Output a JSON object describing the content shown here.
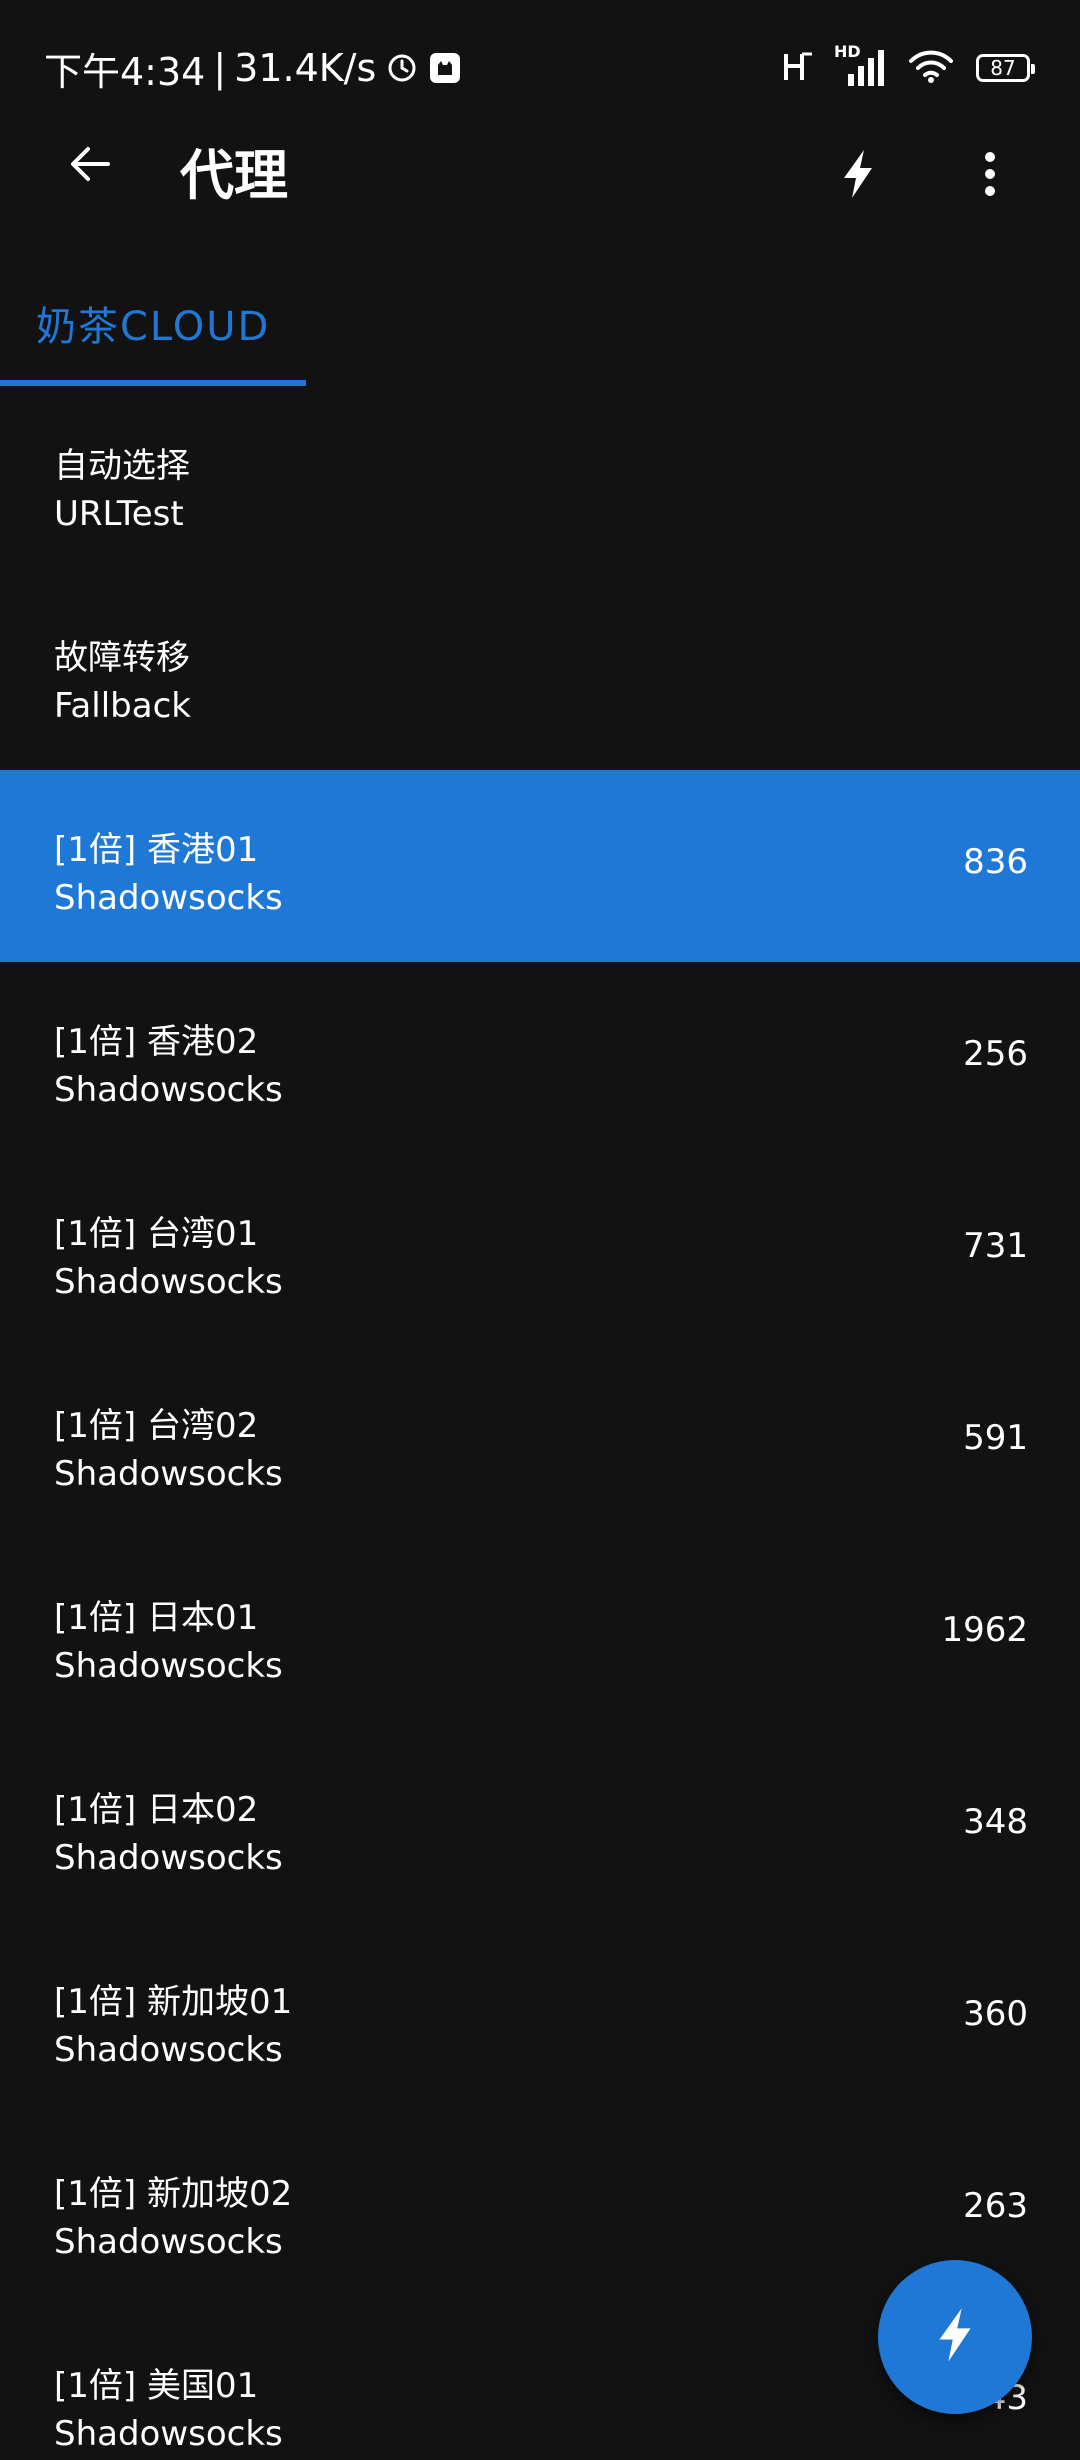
{
  "status_bar": {
    "time": "下午4:34",
    "separator": "|",
    "net_speed": "31.4K/s",
    "battery_level": "87",
    "network_badge": "HD",
    "icons": [
      "alarm-icon",
      "app-notification-icon",
      "hd-voice-icon",
      "signal-icon",
      "wifi-icon",
      "battery-icon"
    ]
  },
  "app_bar": {
    "title": "代理",
    "back_icon": "arrow-left-icon",
    "test_icon": "lightning-icon",
    "more_icon": "more-vert-icon"
  },
  "tabs": [
    {
      "label": "奶茶CLOUD",
      "selected": true
    }
  ],
  "proxies": [
    {
      "name": "自动选择",
      "type": "URLTest",
      "delay": ""
    },
    {
      "name": "故障转移",
      "type": "Fallback",
      "delay": ""
    },
    {
      "name": "[1倍] 香港01",
      "type": "Shadowsocks",
      "delay": "836",
      "selected": true
    },
    {
      "name": "[1倍] 香港02",
      "type": "Shadowsocks",
      "delay": "256"
    },
    {
      "name": "[1倍] 台湾01",
      "type": "Shadowsocks",
      "delay": "731"
    },
    {
      "name": "[1倍] 台湾02",
      "type": "Shadowsocks",
      "delay": "591"
    },
    {
      "name": "[1倍] 日本01",
      "type": "Shadowsocks",
      "delay": "1962"
    },
    {
      "name": "[1倍] 日本02",
      "type": "Shadowsocks",
      "delay": "348"
    },
    {
      "name": "[1倍] 新加坡01",
      "type": "Shadowsocks",
      "delay": "360"
    },
    {
      "name": "[1倍] 新加坡02",
      "type": "Shadowsocks",
      "delay": "263"
    },
    {
      "name": "[1倍] 美国01",
      "type": "Shadowsocks",
      "delay": "1243"
    }
  ],
  "fab": {
    "icon": "lightning-icon"
  },
  "colors": {
    "background": "#121212",
    "accent": "#1f78d6",
    "text": "#ffffff"
  }
}
